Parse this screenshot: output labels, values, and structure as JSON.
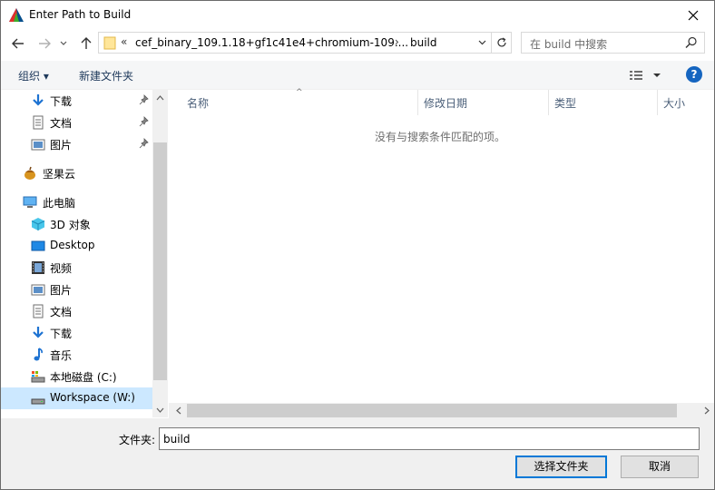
{
  "window": {
    "title": "Enter Path to Build"
  },
  "address": {
    "chevron": "«",
    "path": "cef_binary_109.1.18+gf1c41e4+chromium-109....",
    "separator": "›",
    "current": "build"
  },
  "search": {
    "placeholder": "在 build 中搜索"
  },
  "toolbar": {
    "organize_label": "组织 ▾",
    "new_folder_label": "新建文件夹"
  },
  "sidebar": {
    "items": [
      {
        "label": "下载",
        "icon": "download-arrow-icon",
        "pinned": true
      },
      {
        "label": "文档",
        "icon": "document-icon",
        "pinned": true
      },
      {
        "label": "图片",
        "icon": "picture-icon",
        "pinned": true
      },
      {
        "label": "坚果云",
        "icon": "nutstore-icon",
        "pinned": false
      },
      {
        "label": "此电脑",
        "icon": "computer-icon",
        "pinned": false
      },
      {
        "label": "3D 对象",
        "icon": "3d-objects-icon",
        "pinned": false
      },
      {
        "label": "Desktop",
        "icon": "desktop-icon",
        "pinned": false
      },
      {
        "label": "视频",
        "icon": "video-icon",
        "pinned": false
      },
      {
        "label": "图片",
        "icon": "picture-icon",
        "pinned": false
      },
      {
        "label": "文档",
        "icon": "document-icon",
        "pinned": false
      },
      {
        "label": "下载",
        "icon": "download-arrow-icon",
        "pinned": false
      },
      {
        "label": "音乐",
        "icon": "music-icon",
        "pinned": false
      },
      {
        "label": "本地磁盘 (C:)",
        "icon": "local-disk-icon",
        "pinned": false
      },
      {
        "label": "Workspace (W:)",
        "icon": "drive-icon",
        "pinned": false,
        "selected": true
      }
    ]
  },
  "columns": [
    "名称",
    "修改日期",
    "类型",
    "大小"
  ],
  "content": {
    "empty_message": "没有与搜索条件匹配的项。"
  },
  "footer": {
    "folder_label": "文件夹:",
    "folder_value": "build",
    "select_button": "选择文件夹",
    "cancel_button": "取消"
  },
  "colors": {
    "selection": "#cce8ff",
    "primary_border": "#0078d7",
    "help": "#1565c0",
    "folder_yellow": "#ffd866"
  }
}
